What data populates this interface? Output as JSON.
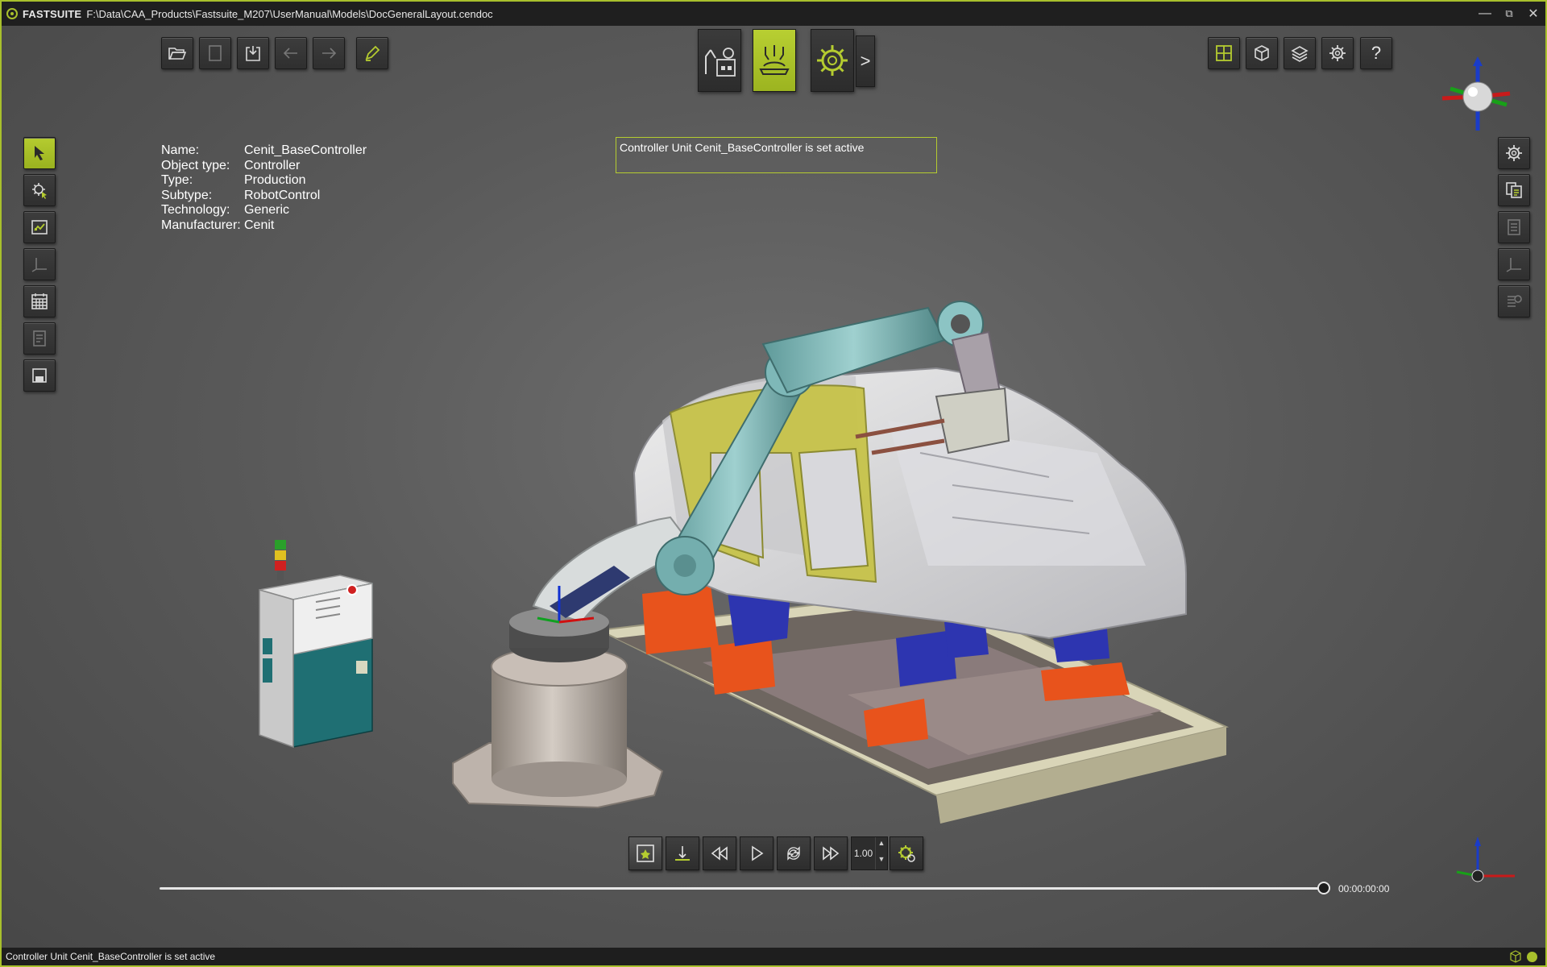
{
  "app": {
    "name": "FASTSUITE",
    "file_path": "F:\\Data\\CAA_Products\\Fastsuite_M207\\UserManual\\Models\\DocGeneralLayout.cendoc",
    "accent_color": "#a8c02c"
  },
  "window_controls": {
    "minimize": "—",
    "restore": "⧉",
    "close": "✕"
  },
  "toolbar_left": [
    {
      "icon": "folder-open-icon"
    },
    {
      "icon": "document-icon"
    },
    {
      "icon": "import-icon"
    },
    {
      "icon": "undo-arrow-icon"
    },
    {
      "icon": "redo-arrow-icon"
    },
    {
      "icon": "pencil-icon"
    }
  ],
  "workbenches": [
    {
      "icon": "robot-layout-icon",
      "active": false
    },
    {
      "icon": "process-station-icon",
      "active": true
    },
    {
      "icon": "gear-settings-icon",
      "active": false
    }
  ],
  "workbench_more": ">",
  "toolbar_right": [
    {
      "icon": "grid-layout-icon"
    },
    {
      "icon": "cube-view-icon"
    },
    {
      "icon": "layers-icon"
    },
    {
      "icon": "gear-icon"
    },
    {
      "icon": "help-icon",
      "label": "?"
    }
  ],
  "properties": {
    "rows": [
      {
        "key": "Name:",
        "value": "Cenit_BaseController"
      },
      {
        "key": "Object type:",
        "value": "Controller"
      },
      {
        "key": "Type:",
        "value": "Production"
      },
      {
        "key": "Subtype:",
        "value": "RobotControl"
      },
      {
        "key": "Technology:",
        "value": "Generic"
      },
      {
        "key": "Manufacturer:",
        "value": "Cenit"
      }
    ]
  },
  "message": "Controller Unit Cenit_BaseController is set active",
  "playback": {
    "speed": "1.00",
    "time": "00:00:00:00",
    "progress": 1.0
  },
  "status": {
    "text": "Controller Unit Cenit_BaseController is set active"
  }
}
